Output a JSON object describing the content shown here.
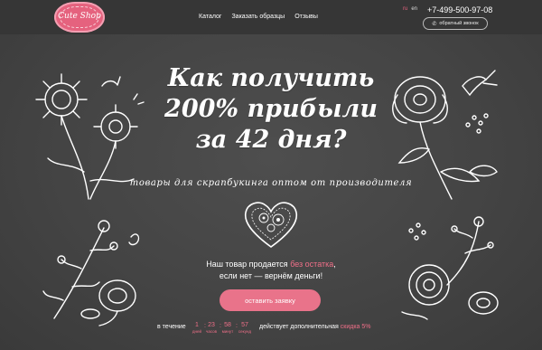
{
  "header": {
    "logo_text": "Cute Shop",
    "nav": [
      "Каталог",
      "Заказать образцы",
      "Отзывы"
    ],
    "lang": {
      "ru": "ru",
      "en": "en"
    },
    "phone": "+7-499-500-97-08",
    "callback_label": "обратный звонок"
  },
  "hero": {
    "headline": [
      "Как получить",
      "200% прибыли",
      "за 42 дня?"
    ],
    "subtitle": "товары для скрапбукинга оптом от производителя",
    "guarantee": {
      "part1": "Наш товар продается ",
      "highlight": "без остатка",
      "part2": ",",
      "line2": "если нет — вернём деньги!"
    },
    "cta_label": "оставить заявку",
    "timer": {
      "prefix": "в течение",
      "units": [
        {
          "value": "1",
          "label": "дней"
        },
        {
          "value": "23",
          "label": "часов"
        },
        {
          "value": "58",
          "label": "минут"
        },
        {
          "value": "57",
          "label": "секунд"
        }
      ],
      "suffix": "действует дополнительная",
      "discount": "скидка 5%"
    }
  },
  "colors": {
    "accent": "#e5627e",
    "background": "#454545",
    "topbar": "#363636"
  }
}
